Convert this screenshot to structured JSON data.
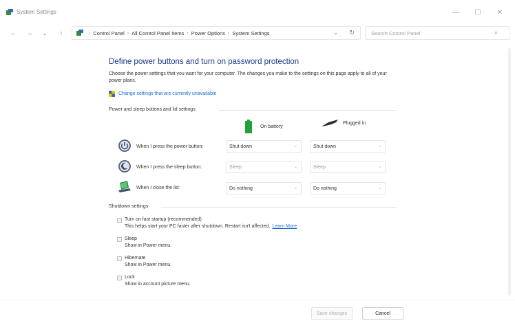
{
  "window": {
    "title": "System Settings",
    "icon": "control-panel-icon",
    "controls": [
      "minimize-icon",
      "maximize-icon",
      "close-icon"
    ]
  },
  "nav": {
    "back": "←",
    "forward": "→",
    "recent": "⌄",
    "up": "↑",
    "breadcrumbs": [
      "Control Panel",
      "All Control Panel Items",
      "Power Options",
      "System Settings"
    ],
    "search_placeholder": "Search Control Panel"
  },
  "page": {
    "heading": "Define power buttons and turn on password protection",
    "description": "Choose the power settings that you want for your computer. The changes you make to the settings on this page apply to all of your power plans.",
    "shield_link": "Change settings that are currently unavailable"
  },
  "power_section": {
    "label": "Power and sleep buttons and lid settings",
    "columns": [
      "On battery",
      "Plugged in"
    ],
    "rows": [
      {
        "label": "When I press the power button:",
        "icon": "power-button-icon",
        "battery": "Shut down",
        "plugged": "Shut down"
      },
      {
        "label": "When I press the sleep button:",
        "icon": "sleep-button-icon",
        "battery": "Sleep",
        "plugged": "Sleep"
      },
      {
        "label": "When I close the lid:",
        "icon": "laptop-lid-icon",
        "battery": "Do nothing",
        "plugged": "Do nothing"
      }
    ]
  },
  "shutdown_section": {
    "label": "Shutdown settings",
    "options": [
      {
        "title": "Turn on fast startup (recommended)",
        "desc": "This helps start your PC faster after shutdown. Restart isn't affected.",
        "link": "Learn More",
        "checked": false
      },
      {
        "title": "Sleep",
        "desc": "Show in Power menu.",
        "checked": false
      },
      {
        "title": "Hibernate",
        "desc": "Show in Power menu.",
        "checked": false
      },
      {
        "title": "Lock",
        "desc": "Show in account picture menu.",
        "checked": false
      }
    ]
  },
  "footer": {
    "save_label": "Save changes",
    "cancel_label": "Cancel"
  },
  "colors": {
    "heading": "#1e3a8a",
    "link": "#1a6fd0",
    "battery_green": "#22a33a"
  }
}
